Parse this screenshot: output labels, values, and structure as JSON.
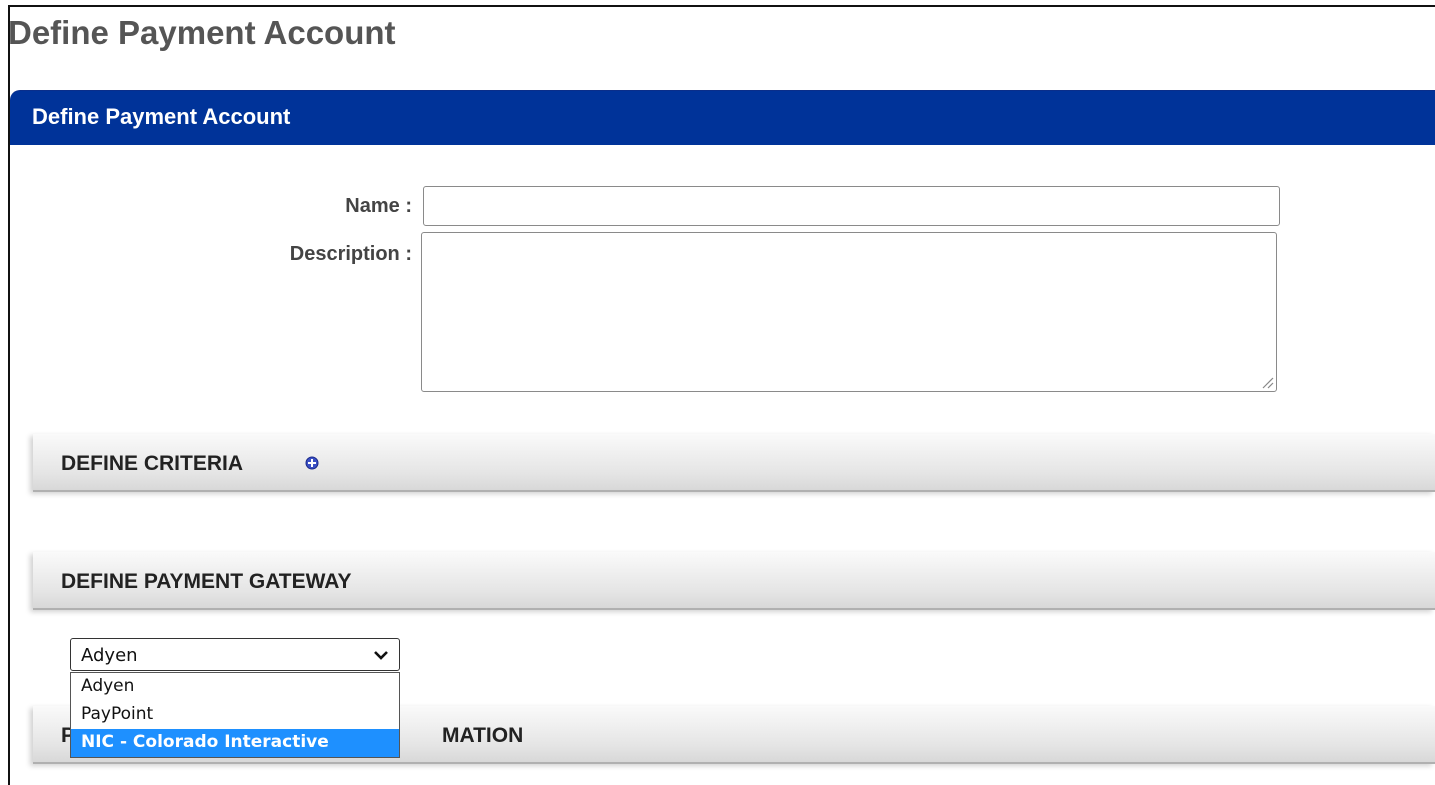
{
  "page": {
    "title": "Define Payment Account"
  },
  "panel": {
    "header": "Define Payment Account"
  },
  "form": {
    "name_label": "Name :",
    "name_value": "",
    "description_label": "Description :",
    "description_value": ""
  },
  "sections": {
    "criteria": "DEFINE CRITERIA",
    "gateway": "DEFINE PAYMENT GATEWAY",
    "payment_info_visible": "P",
    "payment_info_tail": "MATION"
  },
  "gateway_select": {
    "selected": "Adyen",
    "options": [
      "Adyen",
      "PayPoint",
      "NIC - Colorado Interactive"
    ],
    "highlighted": "NIC - Colorado Interactive"
  },
  "colors": {
    "header_bg": "#003399",
    "highlight": "#1e90ff"
  },
  "icons": {
    "add": "plus-circle-icon",
    "dropdown": "chevron-down-icon",
    "resize": "resize-grip-icon"
  }
}
